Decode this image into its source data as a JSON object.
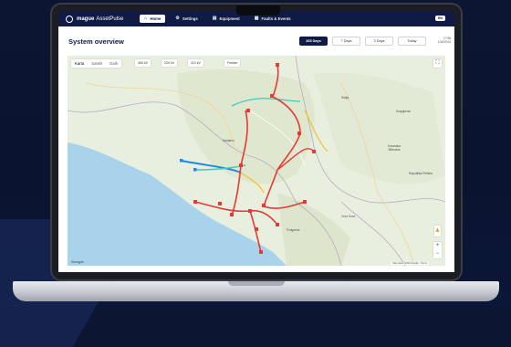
{
  "app": {
    "brand_bold": "mague",
    "brand_light": "AssetPulse"
  },
  "nav": {
    "items": [
      {
        "label": "Home",
        "icon": "home-icon",
        "active": true
      },
      {
        "label": "Settings",
        "icon": "gear-icon",
        "active": false
      },
      {
        "label": "Equipment",
        "icon": "equipment-icon",
        "active": false
      },
      {
        "label": "Faults & Events",
        "icon": "calendar-icon",
        "active": false
      }
    ],
    "badge": "EN"
  },
  "page": {
    "title": "System overview"
  },
  "range_tabs": [
    {
      "label": "365 Days",
      "active": true
    },
    {
      "label": "7 Days",
      "active": false
    },
    {
      "label": "3 Days",
      "active": false
    },
    {
      "label": "Today",
      "active": false
    }
  ],
  "dateinfo": {
    "line1": "17:58",
    "line2": "1/16/2024"
  },
  "map": {
    "map_types": [
      "Karta",
      "Satelit",
      "Dark"
    ],
    "filters": [
      "400 kV",
      "220 kV",
      "110 kV",
      "Feeder"
    ],
    "fullscreen_icon": "fullscreen-icon",
    "zoom_in": "+",
    "zoom_out": "−",
    "logo": "Google",
    "attribution": "Map data ©2024 Google · Terms",
    "places": [
      {
        "name": "Sarajevo"
      },
      {
        "name": "Srbija"
      },
      {
        "name": "Kosovska Mitrovica"
      },
      {
        "name": "Republika Priština"
      },
      {
        "name": "Podgorica"
      },
      {
        "name": "Crna Gora"
      },
      {
        "name": "Kragujevac"
      }
    ]
  },
  "colors": {
    "nav_bg": "#0f1a45",
    "line_red": "#e53935",
    "line_blue": "#1e88e5",
    "line_cyan": "#41c7c7",
    "line_yellow": "#f6c026",
    "sea": "#a8d3ea",
    "land": "#e9efdf"
  }
}
